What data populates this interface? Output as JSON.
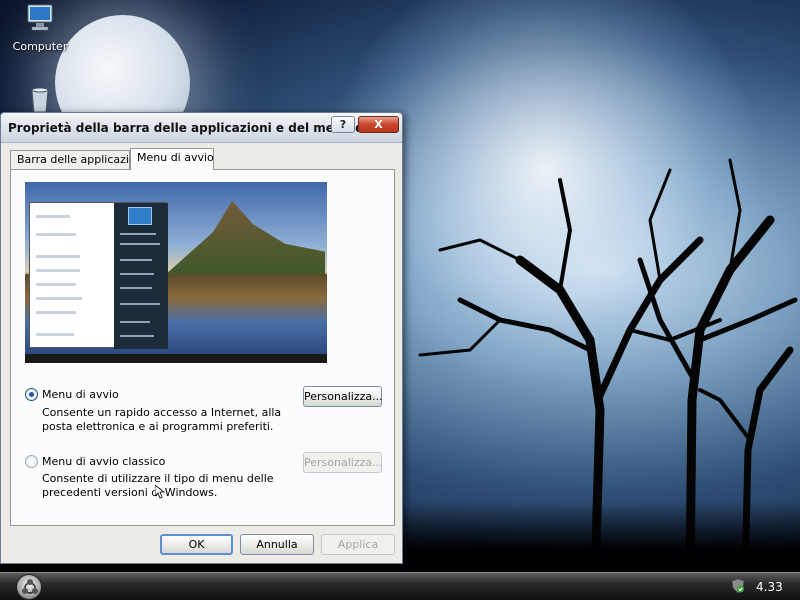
{
  "desktop": {
    "icons": [
      {
        "label": "Computer",
        "icon": "computer-icon"
      },
      {
        "label": "",
        "icon": "recycle-bin-icon"
      }
    ]
  },
  "dialog": {
    "title": "Proprietà della barra delle applicazioni e del menu di ...",
    "help_label": "?",
    "close_label": "X",
    "tabs": [
      {
        "label": "Barra delle applicazioni",
        "selected": false
      },
      {
        "label": "Menu di avvio",
        "selected": true
      }
    ],
    "options": [
      {
        "label": "Menu di avvio",
        "description": "Consente un rapido accesso a Internet, alla posta elettronica e ai programmi preferiti.",
        "checked": true,
        "button_label": "Personalizza...",
        "button_enabled": true
      },
      {
        "label": "Menu di avvio classico",
        "description": "Consente di utilizzare il tipo di menu delle precedenti versioni di Windows.",
        "checked": false,
        "button_label": "Personalizza...",
        "button_enabled": false
      }
    ],
    "buttons": {
      "ok": "OK",
      "cancel": "Annulla",
      "apply": "Applica"
    }
  },
  "taskbar": {
    "clock": "4.33",
    "start_icon": "start-orb-icon",
    "tray_icon": "security-shield-icon"
  },
  "colors": {
    "title_gradient_top": "#f4f6f9",
    "close_button": "#c9452c",
    "dialog_bg": "#ecebe6",
    "taskbar": "#1a1a1a"
  }
}
